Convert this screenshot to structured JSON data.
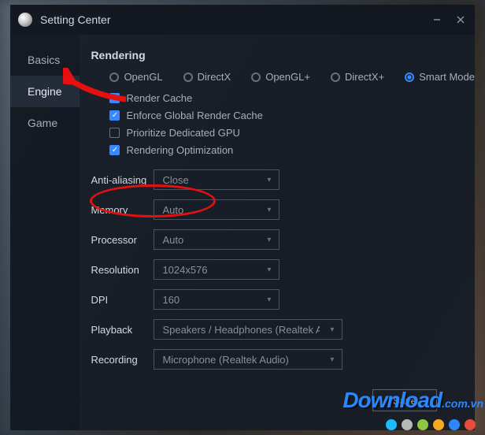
{
  "titlebar": {
    "title": "Setting Center"
  },
  "sidebar": {
    "items": [
      {
        "label": "Basics"
      },
      {
        "label": "Engine"
      },
      {
        "label": "Game"
      }
    ]
  },
  "rendering": {
    "title": "Rendering",
    "radios": [
      {
        "label": "OpenGL",
        "checked": false
      },
      {
        "label": "DirectX",
        "checked": false
      },
      {
        "label": "OpenGL+",
        "checked": false
      },
      {
        "label": "DirectX+",
        "checked": false
      },
      {
        "label": "Smart Mode",
        "checked": true
      }
    ],
    "checks": [
      {
        "label": "Render Cache",
        "checked": true
      },
      {
        "label": "Enforce Global Render Cache",
        "checked": true
      },
      {
        "label": "Prioritize Dedicated GPU",
        "checked": false
      },
      {
        "label": "Rendering Optimization",
        "checked": true
      }
    ]
  },
  "form": {
    "antialiasing": {
      "label": "Anti-aliasing",
      "value": "Close"
    },
    "memory": {
      "label": "Memory",
      "value": "Auto"
    },
    "processor": {
      "label": "Processor",
      "value": "Auto"
    },
    "resolution": {
      "label": "Resolution",
      "value": "1024x576"
    },
    "dpi": {
      "label": "DPI",
      "value": "160"
    },
    "playback": {
      "label": "Playback",
      "value": "Speakers / Headphones (Realtek Audio)"
    },
    "recording": {
      "label": "Recording",
      "value": "Microphone (Realtek Audio)"
    }
  },
  "actions": {
    "save": "Save"
  },
  "watermark": {
    "text": "Download",
    "suffix": ".com.vn"
  },
  "dots": [
    "#1abcff",
    "#b8b8b8",
    "#8ec63f",
    "#f7a823",
    "#2a88ff",
    "#e74c3c"
  ]
}
